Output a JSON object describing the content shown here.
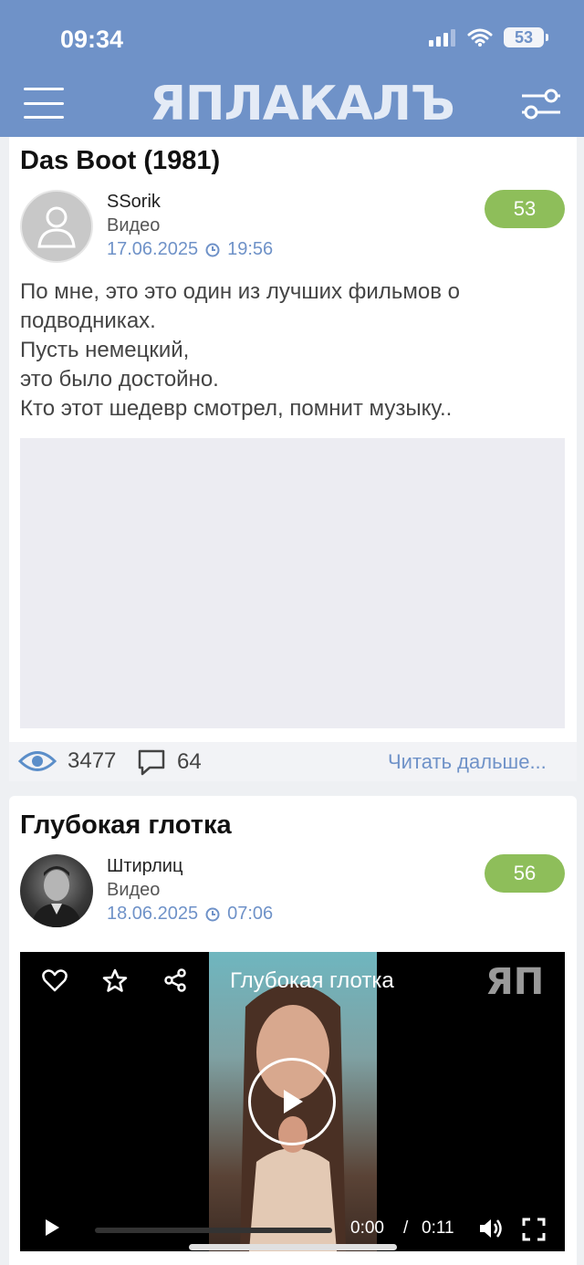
{
  "status_bar": {
    "time": "09:34",
    "battery": "53"
  },
  "header": {
    "logo": "ЯПЛАКАЛЪ"
  },
  "posts": [
    {
      "title": "Das Boot (1981)",
      "author": "SSorik",
      "category": "Видео",
      "date": "17.06.2025",
      "time": "19:56",
      "rating": "53",
      "text_lines": [
        "По мне, это это один из лучших фильмов о",
        "подводниках.",
        "Пусть немецкий,",
        "это было достойно.",
        "Кто этот шедевр смотрел, помнит музыку.."
      ],
      "views": "3477",
      "comments": "64",
      "read_more": "Читать дальше..."
    },
    {
      "title": "Глубокая глотка",
      "author": "Штирлиц",
      "category": "Видео",
      "date": "18.06.2025",
      "time": "07:06",
      "rating": "56",
      "video": {
        "title": "Глубокая глотка",
        "current_time": "0:00",
        "separator": "/",
        "duration": "0:11",
        "watermark": "ЯП"
      }
    }
  ],
  "colors": {
    "header": "#6f92c8",
    "rating": "#8ebe5a",
    "link": "#6f92c8"
  },
  "icons": [
    "menu-icon",
    "filter-icon",
    "clock-icon",
    "eye-icon",
    "comment-icon",
    "heart-icon",
    "star-icon",
    "share-icon",
    "play-icon",
    "volume-icon",
    "fullscreen-icon"
  ]
}
